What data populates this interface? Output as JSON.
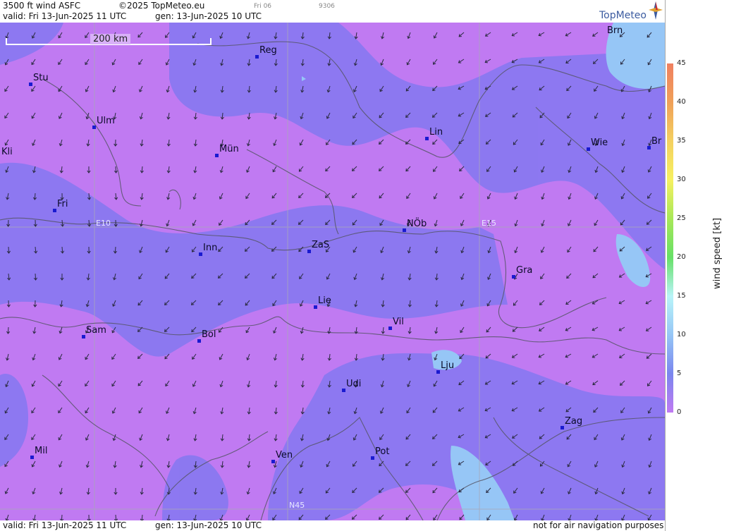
{
  "header": {
    "title": "3500 ft wind ASFC",
    "copyright": "©2025 TopMeteo.eu",
    "day_small": "Fri 06",
    "code_small": "9306",
    "valid": "valid:  Fri  13-Jun-2025  11 UTC",
    "gen": "gen: 13-Jun-2025 10 UTC",
    "logo": "TopMeteo"
  },
  "map": {
    "scale_label": "200 km",
    "grid_labels": {
      "e10": "E10",
      "e15": "E15",
      "n45": "N45"
    },
    "cities": [
      {
        "name": "Reg"
      },
      {
        "name": "Brn"
      },
      {
        "name": "Stu"
      },
      {
        "name": "Ulm"
      },
      {
        "name": "Lin"
      },
      {
        "name": "Mün"
      },
      {
        "name": "Wie"
      },
      {
        "name": "Kli"
      },
      {
        "name": "Br"
      },
      {
        "name": "Fri"
      },
      {
        "name": "NÖb"
      },
      {
        "name": "Inn"
      },
      {
        "name": "ZaS"
      },
      {
        "name": "Gra"
      },
      {
        "name": "Lie"
      },
      {
        "name": "Vil"
      },
      {
        "name": "Sam"
      },
      {
        "name": "Bol"
      },
      {
        "name": "Lju"
      },
      {
        "name": "Udi"
      },
      {
        "name": "Zag"
      },
      {
        "name": "Mil"
      },
      {
        "name": "Ven"
      },
      {
        "name": "Pot"
      }
    ]
  },
  "legend": {
    "ticks": [
      "45",
      "40",
      "35",
      "30",
      "25",
      "20",
      "15",
      "10",
      "5",
      "0"
    ],
    "axis_label": "wind  speed  [kt]",
    "colors": {
      "0": "#c07af2",
      "5": "#8a78f0",
      "10": "#7a86ee",
      "15": "#96c6f6",
      "20": "#b8f4f8",
      "25": "#66e066",
      "30": "#c8f060",
      "35": "#f6f060",
      "40": "#f6b850",
      "45": "#f08060"
    }
  },
  "footer": {
    "valid": "valid:  Fri  13-Jun-2025  11 UTC",
    "gen": "gen: 13-Jun-2025 10 UTC",
    "disclaimer": "not for air navigation purposes"
  }
}
